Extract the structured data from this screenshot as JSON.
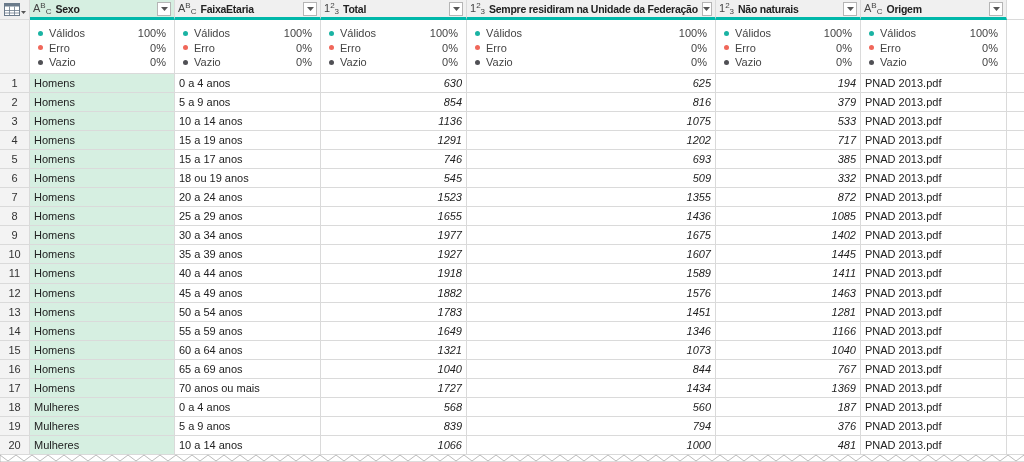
{
  "columns": [
    {
      "title": "Sexo",
      "type_marker": "A$^{B}$$_{C}$",
      "kind": "text",
      "selected": true,
      "quality": [
        {
          "label": "Válidos",
          "value": "100%",
          "color": "#1ab3a3"
        },
        {
          "label": "Erro",
          "value": "0%",
          "color": "#f0675a"
        },
        {
          "label": "Vazio",
          "value": "0%",
          "color": "#505055"
        }
      ]
    },
    {
      "title": "FaixaEtaria",
      "type_marker": "A$^{B}$$_{C}$",
      "kind": "text",
      "selected": false,
      "quality": [
        {
          "label": "Válidos",
          "value": "100%",
          "color": "#1ab3a3"
        },
        {
          "label": "Erro",
          "value": "0%",
          "color": "#f0675a"
        },
        {
          "label": "Vazio",
          "value": "0%",
          "color": "#505055"
        }
      ]
    },
    {
      "title": "Total",
      "type_marker": "1$^{2}$$_{3}$",
      "kind": "number",
      "selected": false,
      "quality": [
        {
          "label": "Válidos",
          "value": "100%",
          "color": "#1ab3a3"
        },
        {
          "label": "Erro",
          "value": "0%",
          "color": "#f0675a"
        },
        {
          "label": "Vazio",
          "value": "0%",
          "color": "#505055"
        }
      ]
    },
    {
      "title": "Sempre residiram na Unidade da Federação",
      "type_marker": "1$^{2}$$_{3}$",
      "kind": "number",
      "selected": false,
      "quality": [
        {
          "label": "Válidos",
          "value": "100%",
          "color": "#1ab3a3"
        },
        {
          "label": "Erro",
          "value": "0%",
          "color": "#f0675a"
        },
        {
          "label": "Vazio",
          "value": "0%",
          "color": "#505055"
        }
      ]
    },
    {
      "title": "Não naturais",
      "type_marker": "1$^{2}$$_{3}$",
      "kind": "number",
      "selected": false,
      "quality": [
        {
          "label": "Válidos",
          "value": "100%",
          "color": "#1ab3a3"
        },
        {
          "label": "Erro",
          "value": "0%",
          "color": "#f0675a"
        },
        {
          "label": "Vazio",
          "value": "0%",
          "color": "#505055"
        }
      ]
    },
    {
      "title": "Origem",
      "type_marker": "A$^{B}$$_{C}$",
      "kind": "text",
      "selected": false,
      "quality": [
        {
          "label": "Válidos",
          "value": "100%",
          "color": "#1ab3a3"
        },
        {
          "label": "Erro",
          "value": "0%",
          "color": "#f0675a"
        },
        {
          "label": "Vazio",
          "value": "0%",
          "color": "#505055"
        }
      ]
    }
  ],
  "rows": [
    [
      "1",
      "Homens",
      "0 a 4 anos",
      "630",
      "625",
      "194",
      "PNAD 2013.pdf"
    ],
    [
      "2",
      "Homens",
      "5 a 9 anos",
      "854",
      "816",
      "379",
      "PNAD 2013.pdf"
    ],
    [
      "3",
      "Homens",
      "10 a 14 anos",
      "1136",
      "1075",
      "533",
      "PNAD 2013.pdf"
    ],
    [
      "4",
      "Homens",
      "15 a 19 anos",
      "1291",
      "1202",
      "717",
      "PNAD 2013.pdf"
    ],
    [
      "5",
      "Homens",
      "15 a 17 anos",
      "746",
      "693",
      "385",
      "PNAD 2013.pdf"
    ],
    [
      "6",
      "Homens",
      "18 ou 19 anos",
      "545",
      "509",
      "332",
      "PNAD 2013.pdf"
    ],
    [
      "7",
      "Homens",
      "20 a 24 anos",
      "1523",
      "1355",
      "872",
      "PNAD 2013.pdf"
    ],
    [
      "8",
      "Homens",
      "25 a 29 anos",
      "1655",
      "1436",
      "1085",
      "PNAD 2013.pdf"
    ],
    [
      "9",
      "Homens",
      "30 a 34 anos",
      "1977",
      "1675",
      "1402",
      "PNAD 2013.pdf"
    ],
    [
      "10",
      "Homens",
      "35 a 39 anos",
      "1927",
      "1607",
      "1445",
      "PNAD 2013.pdf"
    ],
    [
      "11",
      "Homens",
      "40 a 44 anos",
      "1918",
      "1589",
      "1411",
      "PNAD 2013.pdf"
    ],
    [
      "12",
      "Homens",
      "45 a 49 anos",
      "1882",
      "1576",
      "1463",
      "PNAD 2013.pdf"
    ],
    [
      "13",
      "Homens",
      "50 a 54 anos",
      "1783",
      "1451",
      "1281",
      "PNAD 2013.pdf"
    ],
    [
      "14",
      "Homens",
      "55 a 59 anos",
      "1649",
      "1346",
      "1166",
      "PNAD 2013.pdf"
    ],
    [
      "15",
      "Homens",
      "60 a 64 anos",
      "1321",
      "1073",
      "1040",
      "PNAD 2013.pdf"
    ],
    [
      "16",
      "Homens",
      "65 a 69 anos",
      "1040",
      "844",
      "767",
      "PNAD 2013.pdf"
    ],
    [
      "17",
      "Homens",
      "70 anos ou mais",
      "1727",
      "1434",
      "1369",
      "PNAD 2013.pdf"
    ],
    [
      "18",
      "Mulheres",
      "0 a 4 anos",
      "568",
      "560",
      "187",
      "PNAD 2013.pdf"
    ],
    [
      "19",
      "Mulheres",
      "5 a 9 anos",
      "839",
      "794",
      "376",
      "PNAD 2013.pdf"
    ],
    [
      "20",
      "Mulheres",
      "10 a 14 anos",
      "1066",
      "1000",
      "481",
      "PNAD 2013.pdf"
    ]
  ]
}
